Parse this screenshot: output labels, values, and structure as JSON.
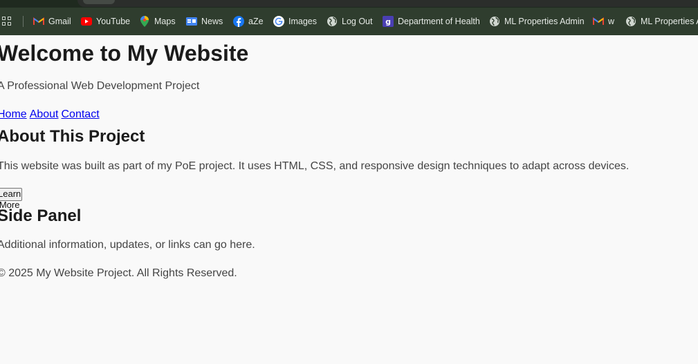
{
  "bookmarks_bar": {
    "items": [
      {
        "label": "Gmail",
        "icon": "gmail-icon"
      },
      {
        "label": "YouTube",
        "icon": "youtube-icon"
      },
      {
        "label": "Maps",
        "icon": "maps-icon"
      },
      {
        "label": "News",
        "icon": "news-icon"
      },
      {
        "label": "aZe",
        "icon": "facebook-icon"
      },
      {
        "label": "Images",
        "icon": "google-icon"
      },
      {
        "label": "Log Out",
        "icon": "globe-icon"
      },
      {
        "label": "Department of Health",
        "icon": "g-logo-icon"
      },
      {
        "label": "ML Properties Admin",
        "icon": "globe-icon"
      },
      {
        "label": "w",
        "icon": "gmail-icon"
      },
      {
        "label": "ML Properties A",
        "icon": "globe-icon"
      }
    ]
  },
  "page": {
    "title": "Welcome to My Website",
    "tagline": "A Professional Web Development Project",
    "nav": [
      "Home",
      "About",
      "Contact"
    ],
    "about": {
      "heading": "About This Project",
      "text": "This website was built as part of my PoE project. It uses HTML, CSS, and responsive design techniques to adapt across devices.",
      "button_label": "Learn More"
    },
    "side_panel": {
      "heading": "Side Panel",
      "text": "Additional information, updates, or links can go here."
    },
    "footer": "© 2025 My Website Project. All Rights Reserved."
  }
}
